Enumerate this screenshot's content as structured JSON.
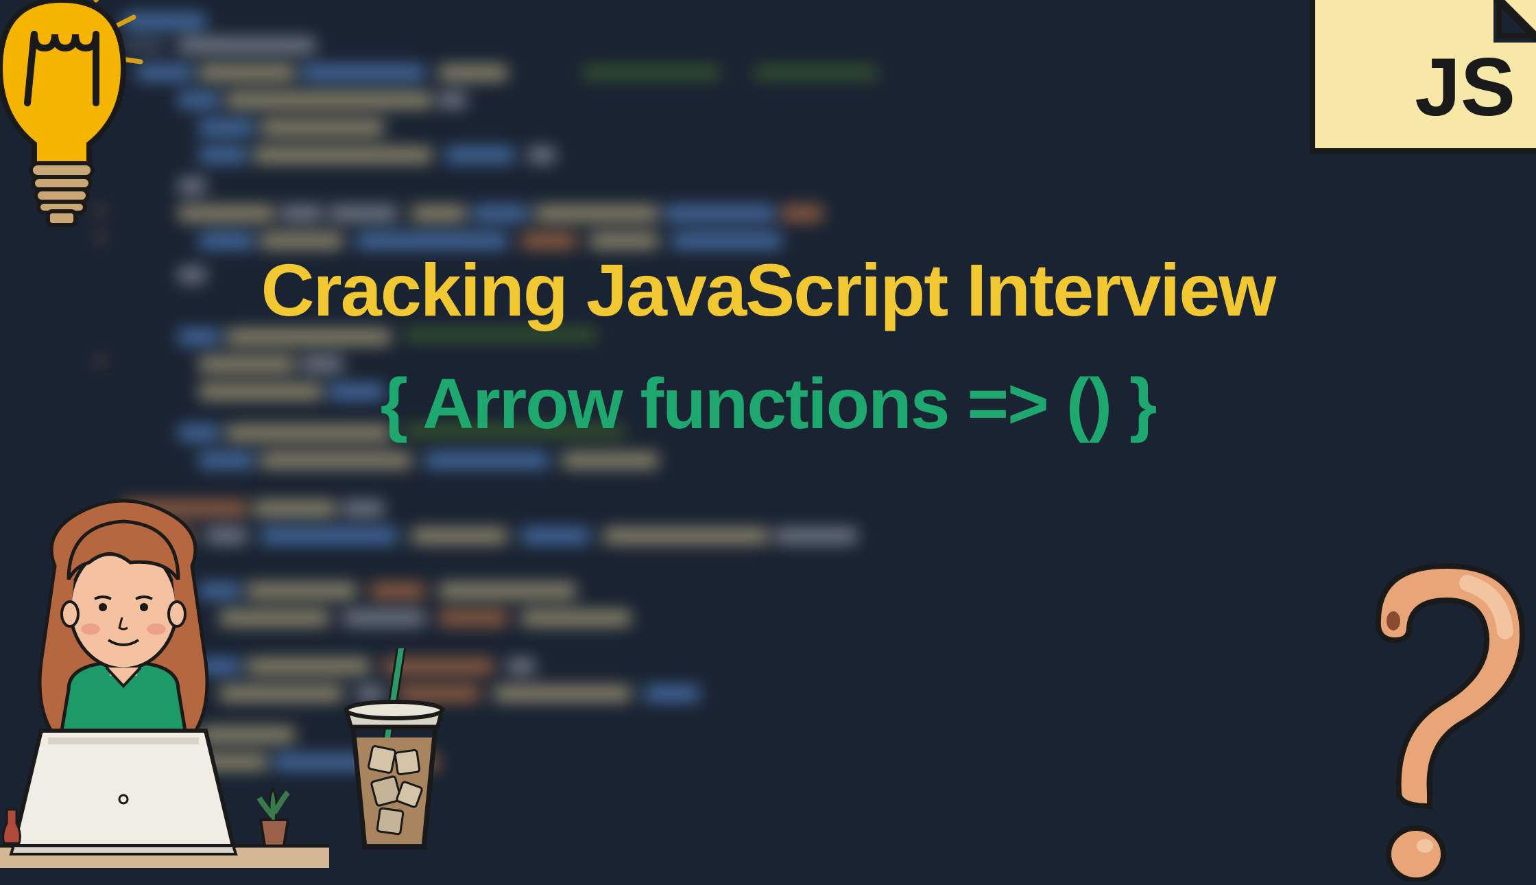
{
  "title": "Cracking JavaScript Interview",
  "subtitle": "{ Arrow functions => () }",
  "badge_text": "JS",
  "colors": {
    "background": "#1a2332",
    "title": "#f2c832",
    "subtitle": "#1ea86f",
    "badge_bg": "#f7e8a7",
    "badge_text": "#1a1a1a"
  },
  "decorations": {
    "lightbulb": "lightbulb-icon",
    "person": "woman-at-laptop-icon",
    "drink": "iced-coffee-icon",
    "question": "question-mark-icon",
    "badge": "js-file-badge"
  }
}
